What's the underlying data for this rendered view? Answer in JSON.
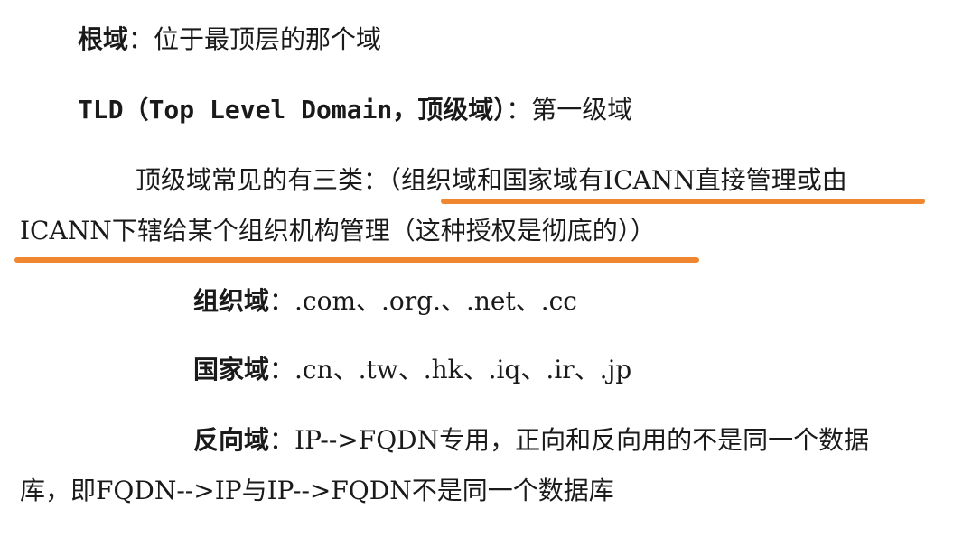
{
  "colors": {
    "text": "#1a1a1a",
    "highlight_underline": "#f0862f"
  },
  "lines": {
    "root_term": "根域",
    "root_desc": "：位于最顶层的那个域",
    "tld_term": "TLD（Top Level Domain，顶级域）",
    "tld_desc": "：第一级域",
    "tld_types_lead": "顶级域常见的有三类：",
    "tld_types_paren_start": "（组织域和国家域有ICANN直接管理或由",
    "tld_types_paren_end": "ICANN下辖给某个组织机构管理（这种授权是彻底的））",
    "org_term": "组织域",
    "org_desc": "：.com、.org.、.net、.cc",
    "country_term": "国家域",
    "country_desc": "：.cn、.tw、.hk、.iq、.ir、.jp",
    "reverse_term": "反向域",
    "reverse_desc": "：IP-->FQDN专用，正向和反向用的不是同一个数据",
    "reverse_desc_cont": "库，即FQDN-->IP与IP-->FQDN不是同一个数据库"
  }
}
